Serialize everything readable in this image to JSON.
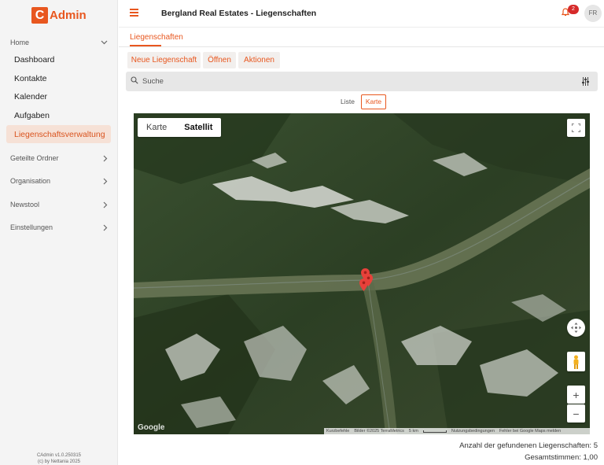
{
  "app": {
    "logo_letter": "C",
    "logo_text": "Admin",
    "version": "CAdmin v1.0.250315",
    "copyright": "(c) by Nettania 2025"
  },
  "sidebar": {
    "home_label": "Home",
    "sub_items": [
      "Dashboard",
      "Kontakte",
      "Kalender",
      "Aufgaben",
      "Liegenschaftsverwaltung"
    ],
    "groups": [
      "Geteilte Ordner",
      "Organisation",
      "Newstool",
      "Einstellungen"
    ]
  },
  "header": {
    "title": "Bergland Real Estates - Liegenschaften",
    "notification_count": "2",
    "user_initials": "FR"
  },
  "tabs": {
    "main": "Liegenschaften"
  },
  "toolbar": {
    "new": "Neue Liegenschaft",
    "open": "Öffnen",
    "actions": "Aktionen"
  },
  "search": {
    "placeholder": "Suche"
  },
  "view_toggle": {
    "list": "Liste",
    "map": "Karte",
    "active": "map"
  },
  "map": {
    "type_map": "Karte",
    "type_satellite": "Satellit",
    "active_type": "Satellit",
    "attribution": "Google",
    "footer": {
      "shortcuts": "Kurzbefehle",
      "imagery": "Bilder ©2025 TerraMetrics",
      "scale": "5 km",
      "terms": "Nutzungsbedingungen",
      "report": "Fehler bei Google Maps melden"
    },
    "zoom_in": "+",
    "zoom_out": "−",
    "marker_color": "#e8413a"
  },
  "stats": {
    "found": "Anzahl der gefundenen Liegenschaften: 5",
    "votes": "Gesamtstimmen: 1,00"
  },
  "colors": {
    "accent": "#e8571f",
    "active_bg": "#f6e1d6"
  }
}
